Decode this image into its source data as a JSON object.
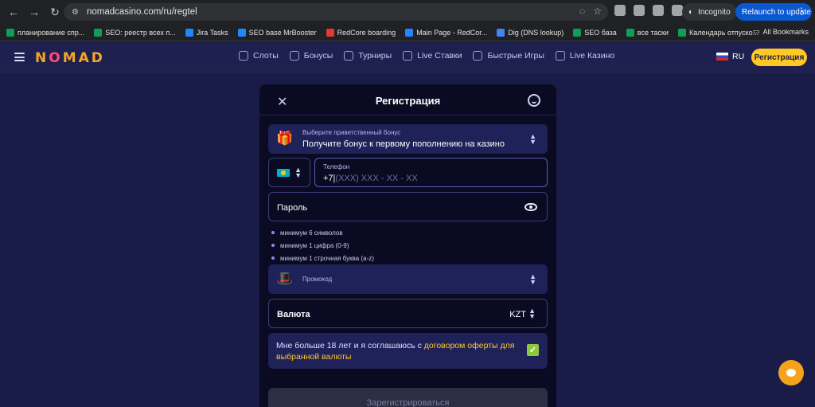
{
  "browser": {
    "url": "nomadcasino.com/ru/regtel",
    "incognito_label": "Incognito",
    "relaunch_label": "Relaunch to update",
    "bookmarks": [
      {
        "label": "планирование спр...",
        "color": "#0f9d58"
      },
      {
        "label": "SEO: реестр всех п...",
        "color": "#0f9d58"
      },
      {
        "label": "Jira Tasks",
        "color": "#2684ff"
      },
      {
        "label": "SEO base MrBooster",
        "color": "#2684ff"
      },
      {
        "label": "RedCore boarding",
        "color": "#e53935"
      },
      {
        "label": "Main Page - RedCor...",
        "color": "#2684ff"
      },
      {
        "label": "Dig (DNS lookup)",
        "color": "#4285f4"
      },
      {
        "label": "SEO база",
        "color": "#0f9d58"
      },
      {
        "label": "все таски",
        "color": "#0f9d58"
      },
      {
        "label": "Календарь отпуско...",
        "color": "#0f9d58"
      }
    ],
    "all_bookmarks_label": "All Bookmarks"
  },
  "site": {
    "logo": {
      "pre": "N",
      "o": "O",
      "post": "MAD"
    },
    "nav": [
      {
        "label": "Слоты",
        "icon": "slots-icon"
      },
      {
        "label": "Бонусы",
        "icon": "gift-icon"
      },
      {
        "label": "Турниры",
        "icon": "trophy-icon"
      },
      {
        "label": "Live Ставки",
        "icon": "live-bets-icon"
      },
      {
        "label": "Быстрые Игры",
        "icon": "rocket-icon"
      },
      {
        "label": "Live Казино",
        "icon": "cards-icon"
      }
    ],
    "language": "RU",
    "register_button": "Регистрация",
    "accent": "#ffc823"
  },
  "modal": {
    "title": "Регистрация",
    "bonus": {
      "label": "Выберите приветственный бонус",
      "value": "Получите бонус к первому пополнению на казино"
    },
    "phone": {
      "label": "Телефон",
      "prefix": "+7",
      "placeholder": "(XXX) XXX - XX - XX"
    },
    "password": {
      "placeholder": "Пароль"
    },
    "password_rules": [
      "минимум 6 символов",
      "минимум 1 цифра (0-9)",
      "минимум 1 строчная буква (a-z)"
    ],
    "promo": {
      "label": "Промокод"
    },
    "currency": {
      "label": "Валюта",
      "value": "KZT"
    },
    "agreement": {
      "text": "Мне больше 18 лет и я соглашаюсь с ",
      "link": "договором оферты для выбранной валюты",
      "checked": true
    },
    "submit_label": "Зарегистрироваться"
  }
}
